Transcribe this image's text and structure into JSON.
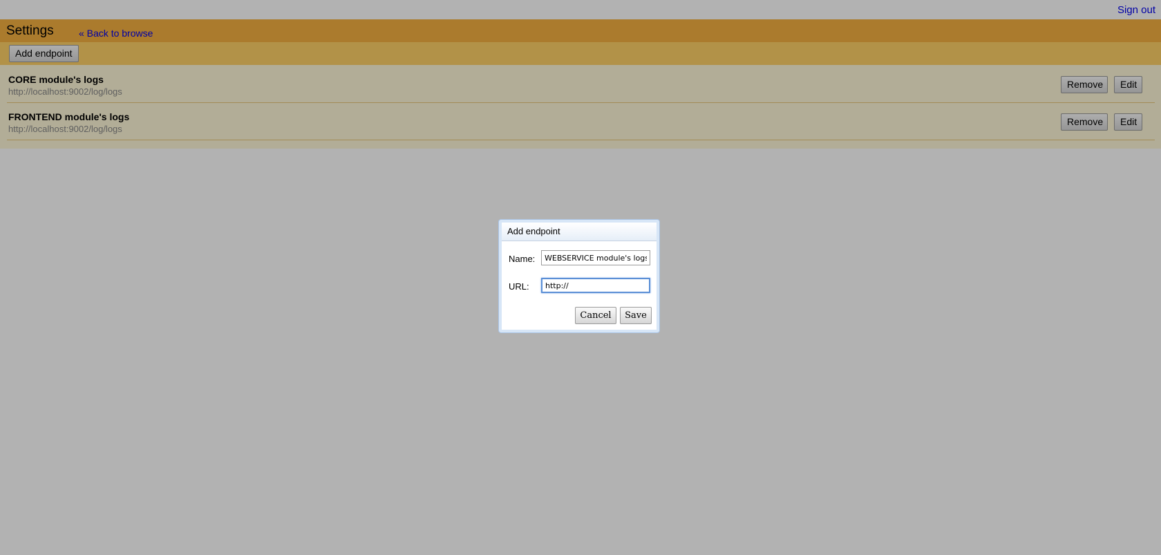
{
  "topbar": {
    "signout_label": "Sign out"
  },
  "header": {
    "title": "Settings",
    "back_link": "« Back to browse"
  },
  "toolbar": {
    "add_endpoint_label": "Add endpoint"
  },
  "endpoints": [
    {
      "name": "CORE module's logs",
      "url": "http://localhost:9002/log/logs",
      "remove_label": "Remove",
      "edit_label": "Edit"
    },
    {
      "name": "FRONTEND module's logs",
      "url": "http://localhost:9002/log/logs",
      "remove_label": "Remove",
      "edit_label": "Edit"
    }
  ],
  "dialog": {
    "title": "Add endpoint",
    "name_label": "Name:",
    "name_value": "WEBSERVICE module's logs",
    "url_label": "URL:",
    "url_value": "http://",
    "cancel_label": "Cancel",
    "save_label": "Save"
  },
  "colors": {
    "header": "#f5b041",
    "toolbar": "#ffd268",
    "list": "#fff8d8",
    "link": "#0000ee",
    "overlay": "rgba(0,0,0,0.3)"
  }
}
